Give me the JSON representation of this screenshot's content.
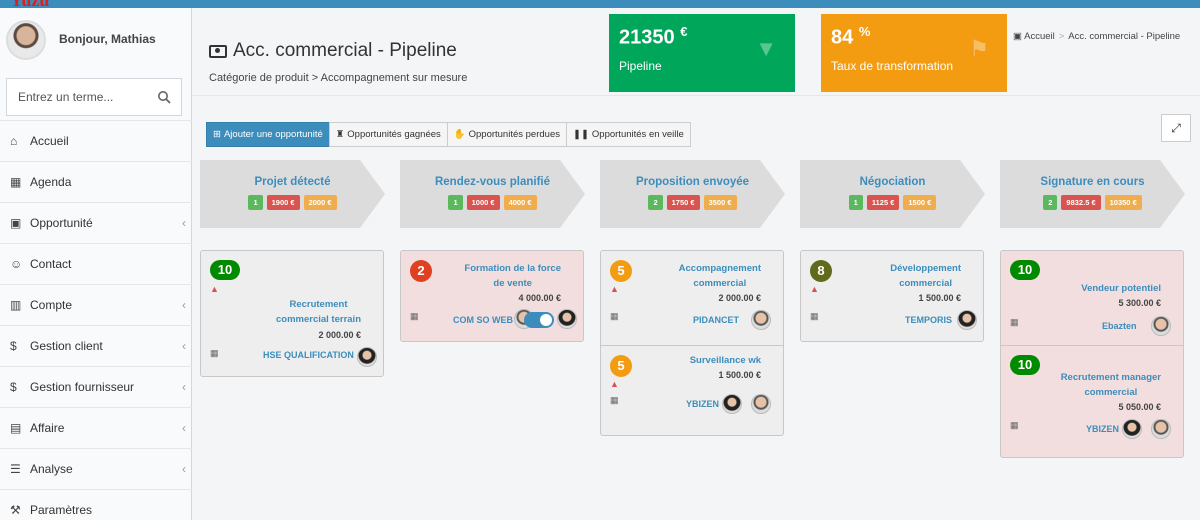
{
  "brand": "Yuzu",
  "user": {
    "greeting": "Bonjour, Mathias"
  },
  "search": {
    "placeholder": "Entrez un terme..."
  },
  "menu": [
    {
      "label": "Accueil",
      "icon": "home-icon",
      "glyph": "⌂",
      "chevron": false
    },
    {
      "label": "Agenda",
      "icon": "calendar-icon",
      "glyph": "▦",
      "chevron": false
    },
    {
      "label": "Opportunité",
      "icon": "money-icon",
      "glyph": "▣",
      "chevron": true
    },
    {
      "label": "Contact",
      "icon": "users-icon",
      "glyph": "☺",
      "chevron": false
    },
    {
      "label": "Compte",
      "icon": "building-icon",
      "glyph": "▥",
      "chevron": true
    },
    {
      "label": "Gestion client",
      "icon": "dollar-icon",
      "glyph": "$",
      "chevron": true
    },
    {
      "label": "Gestion fournisseur",
      "icon": "dollar-icon",
      "glyph": "$",
      "chevron": true
    },
    {
      "label": "Affaire",
      "icon": "briefcase-icon",
      "glyph": "▤",
      "chevron": true
    },
    {
      "label": "Analyse",
      "icon": "list-icon",
      "glyph": "☰",
      "chevron": true
    },
    {
      "label": "Paramètres",
      "icon": "wrench-icon",
      "glyph": "⚒",
      "chevron": false
    }
  ],
  "page": {
    "title": "Acc. commercial - Pipeline",
    "subtitle": "Catégorie de produit > Accompagnement sur mesure"
  },
  "kpis": {
    "pipeline": {
      "value": "21350",
      "unit": "€",
      "label": "Pipeline",
      "color": "#00a65a"
    },
    "rate": {
      "value": "84",
      "unit": "%",
      "label": "Taux de transformation",
      "color": "#f39c12"
    }
  },
  "breadcrumb": {
    "home": "Accueil",
    "current": "Acc. commercial - Pipeline"
  },
  "toolbar": {
    "add": "Ajouter une opportunité",
    "won": "Opportunités gagnées",
    "lost": "Opportunités perdues",
    "standby": "Opportunités en veille"
  },
  "columns": [
    {
      "name": "Projet détecté",
      "count": "1",
      "amount": "1900 €",
      "weighted": "2000 €"
    },
    {
      "name": "Rendez-vous planifié",
      "count": "1",
      "amount": "1000 €",
      "weighted": "4000 €"
    },
    {
      "name": "Proposition envoyée",
      "count": "2",
      "amount": "1750 €",
      "weighted": "3500 €"
    },
    {
      "name": "Négociation",
      "count": "1",
      "amount": "1125 €",
      "weighted": "1500 €"
    },
    {
      "name": "Signature en cours",
      "count": "2",
      "amount": "9832.5 €",
      "weighted": "10350 €"
    }
  ],
  "cards": {
    "c1": {
      "score": "10",
      "title1": "Recrutement",
      "title2": "commercial terrain",
      "amount": "2 000.00 €",
      "company": "HSE QUALIFICATION"
    },
    "c2": {
      "score": "2",
      "title1": "Formation de la force",
      "title2": "de vente",
      "amount": "4 000.00 €",
      "company": "COM SO WEB"
    },
    "c3a": {
      "score": "5",
      "title1": "Accompagnement",
      "title2": "commercial",
      "amount": "2 000.00 €",
      "company": "PIDANCET"
    },
    "c3b": {
      "score": "5",
      "title1": "Surveillance wk",
      "amount": "1 500.00 €",
      "company": "YBIZEN"
    },
    "c4": {
      "score": "8",
      "title1": "Développement",
      "title2": "commercial",
      "amount": "1 500.00 €",
      "company": "TEMPORIS"
    },
    "c5a": {
      "score": "10",
      "title1": "Vendeur potentiel",
      "amount": "5 300.00 €",
      "company": "Ebazten"
    },
    "c5b": {
      "score": "10",
      "title1": "Recrutement manager",
      "title2": "commercial",
      "amount": "5 050.00 €",
      "company": "YBIZEN"
    }
  },
  "colors": {
    "accent": "#3c8dbc",
    "green": "#00a65a",
    "orange": "#f39c12",
    "red": "#d9534f",
    "pink_card": "#f2dede"
  }
}
